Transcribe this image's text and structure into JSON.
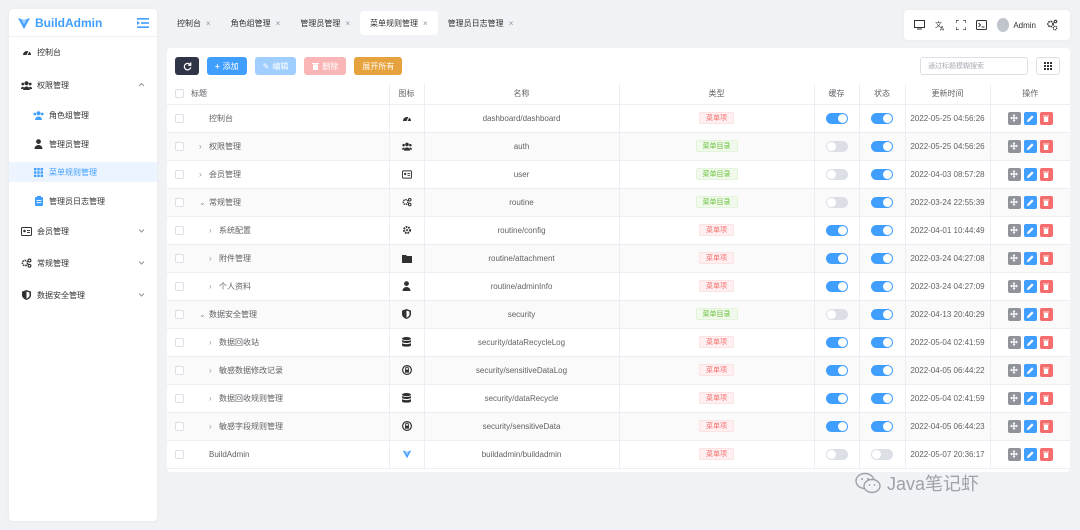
{
  "brand": {
    "name": "BuildAdmin",
    "color": "#409eff"
  },
  "sidebar": {
    "items": [
      {
        "label": "控制台",
        "icon": "dashboard-icon",
        "level": 0
      },
      {
        "label": "权限管理",
        "icon": "users-icon",
        "level": 0,
        "expanded": true
      },
      {
        "label": "角色组管理",
        "icon": "group-icon",
        "level": 1
      },
      {
        "label": "管理员管理",
        "icon": "user-icon",
        "level": 1
      },
      {
        "label": "菜单规则管理",
        "icon": "grid-icon",
        "level": 1,
        "active": true
      },
      {
        "label": "管理员日志管理",
        "icon": "log-icon",
        "level": 1
      },
      {
        "label": "会员管理",
        "icon": "id-card-icon",
        "level": 0
      },
      {
        "label": "常规管理",
        "icon": "cogs-icon",
        "level": 0
      },
      {
        "label": "数据安全管理",
        "icon": "shield-icon",
        "level": 0
      }
    ]
  },
  "tabs": [
    {
      "label": "控制台",
      "active": false
    },
    {
      "label": "角色组管理",
      "active": false
    },
    {
      "label": "管理员管理",
      "active": false
    },
    {
      "label": "菜单规则管理",
      "active": true
    },
    {
      "label": "管理员日志管理",
      "active": false
    }
  ],
  "topbar": {
    "user": "Admin"
  },
  "toolbar": {
    "add": "添加",
    "edit": "编辑",
    "delete": "删除",
    "expand_all": "展开所有",
    "search_placeholder": "通过标题模糊搜索"
  },
  "table": {
    "headers": {
      "title": "标题",
      "icon": "图标",
      "name": "名称",
      "type": "类型",
      "cache": "缓存",
      "status": "状态",
      "updated": "更新时间",
      "actions": "操作"
    },
    "rows": [
      {
        "title": "控制台",
        "level": 0,
        "caret": "",
        "icon": "dashboard-icon",
        "name": "dashboard/dashboard",
        "type": "菜单项",
        "type_style": "danger",
        "cache": true,
        "status": true,
        "updated": "2022-05-25 04:56:26"
      },
      {
        "title": "权限管理",
        "level": 0,
        "caret": "›",
        "icon": "users-icon",
        "name": "auth",
        "type": "菜单目录",
        "type_style": "success",
        "cache": false,
        "status": true,
        "updated": "2022-05-25 04:56:26"
      },
      {
        "title": "会员管理",
        "level": 0,
        "caret": "›",
        "icon": "id-card-icon",
        "name": "user",
        "type": "菜单目录",
        "type_style": "success",
        "cache": false,
        "status": true,
        "updated": "2022-04-03 08:57:28"
      },
      {
        "title": "常规管理",
        "level": 0,
        "caret": "⌄",
        "icon": "cogs-icon",
        "name": "routine",
        "type": "菜单目录",
        "type_style": "success",
        "cache": false,
        "status": true,
        "updated": "2022-03-24 22:55:39"
      },
      {
        "title": "系统配置",
        "level": 1,
        "caret": "›",
        "icon": "gear-icon",
        "name": "routine/config",
        "type": "菜单项",
        "type_style": "danger",
        "cache": true,
        "status": true,
        "updated": "2022-04-01 10:44:49"
      },
      {
        "title": "附件管理",
        "level": 1,
        "caret": "›",
        "icon": "folder-icon",
        "name": "routine/attachment",
        "type": "菜单项",
        "type_style": "danger",
        "cache": true,
        "status": true,
        "updated": "2022-03-24 04:27:08"
      },
      {
        "title": "个人资料",
        "level": 1,
        "caret": "›",
        "icon": "user-icon",
        "name": "routine/adminInfo",
        "type": "菜单项",
        "type_style": "danger",
        "cache": true,
        "status": true,
        "updated": "2022-03-24 04:27:09"
      },
      {
        "title": "数据安全管理",
        "level": 0,
        "caret": "⌄",
        "icon": "shield-icon",
        "name": "security",
        "type": "菜单目录",
        "type_style": "success",
        "cache": false,
        "status": true,
        "updated": "2022-04-13 20:40:29"
      },
      {
        "title": "数据回收站",
        "level": 1,
        "caret": "›",
        "icon": "database-icon",
        "name": "security/dataRecycleLog",
        "type": "菜单项",
        "type_style": "danger",
        "cache": true,
        "status": true,
        "updated": "2022-05-04 02:41:59"
      },
      {
        "title": "敏感数据修改记录",
        "level": 1,
        "caret": "›",
        "icon": "lock-icon",
        "name": "security/sensitiveDataLog",
        "type": "菜单项",
        "type_style": "danger",
        "cache": true,
        "status": true,
        "updated": "2022-04-05 06:44:22"
      },
      {
        "title": "数据回收规则管理",
        "level": 1,
        "caret": "›",
        "icon": "database-icon",
        "name": "security/dataRecycle",
        "type": "菜单项",
        "type_style": "danger",
        "cache": true,
        "status": true,
        "updated": "2022-05-04 02:41:59"
      },
      {
        "title": "敏感字段规则管理",
        "level": 1,
        "caret": "›",
        "icon": "lock-icon",
        "name": "security/sensitiveData",
        "type": "菜单项",
        "type_style": "danger",
        "cache": true,
        "status": true,
        "updated": "2022-04-05 06:44:23"
      },
      {
        "title": "BuildAdmin",
        "level": 0,
        "caret": "",
        "icon": "logo-icon",
        "name": "buildadmin/buildadmin",
        "type": "菜单项",
        "type_style": "danger",
        "cache": false,
        "status": false,
        "updated": "2022-05-07 20:36:17"
      }
    ]
  },
  "watermark": {
    "text": "Java笔记虾"
  }
}
